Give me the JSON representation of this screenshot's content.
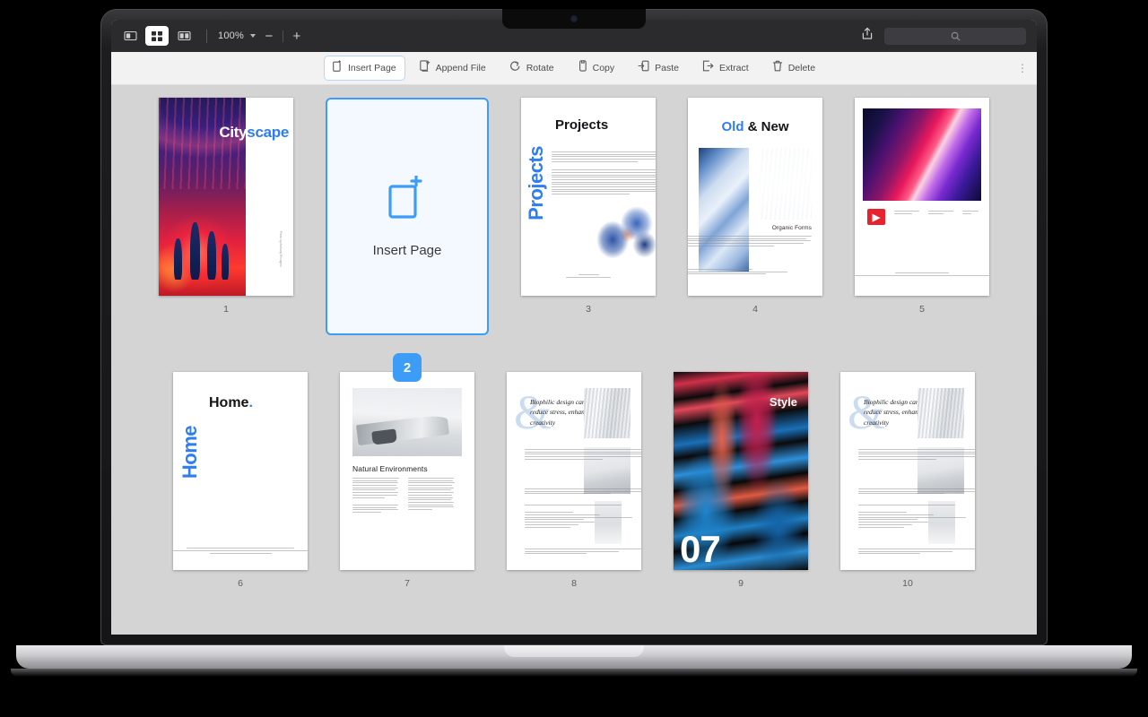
{
  "titlebar": {
    "view_icons": [
      {
        "name": "single-page-view-icon",
        "active": false
      },
      {
        "name": "thumbnail-grid-view-icon",
        "active": true
      },
      {
        "name": "two-page-view-icon",
        "active": false
      }
    ],
    "zoom_value": "100%",
    "zoom_out_label": "−",
    "zoom_in_label": "+",
    "share_icon": "share-icon",
    "search_icon": "search-icon",
    "search_placeholder": ""
  },
  "toolbar": {
    "items": [
      {
        "label": "Insert Page",
        "icon": "insert-page-icon",
        "selected": true
      },
      {
        "label": "Append File",
        "icon": "append-file-icon",
        "selected": false
      },
      {
        "label": "Rotate",
        "icon": "rotate-icon",
        "selected": false
      },
      {
        "label": "Copy",
        "icon": "copy-icon",
        "selected": false
      },
      {
        "label": "Paste",
        "icon": "paste-icon",
        "selected": false
      },
      {
        "label": "Extract",
        "icon": "extract-icon",
        "selected": false
      },
      {
        "label": "Delete",
        "icon": "delete-icon",
        "selected": false
      }
    ],
    "overflow_label": "⋮"
  },
  "insert_card": {
    "label": "Insert Page",
    "icon": "page-plus-icon",
    "accent_color": "#3d9cf5"
  },
  "drag_badge": {
    "value": "2",
    "color": "#3d9cf5"
  },
  "pages": {
    "p1": {
      "number": "1",
      "title_white": "City",
      "title_blue": "scape",
      "side_note": "Photo by Anthony Reungère"
    },
    "p3": {
      "number": "3",
      "title": "Projects",
      "vertical_title": "Projects",
      "footer_line1": "Photo by",
      "footer_line2": "Documentation for compilation"
    },
    "p4": {
      "number": "4",
      "title_blue": "Old",
      "title_dark": "& New",
      "subtitle": "Organic Forms"
    },
    "p5": {
      "number": "5",
      "logo_glyph": "▶"
    },
    "p6": {
      "number": "6",
      "title": "Home",
      "title_dot": ".",
      "vertical_title": "Home",
      "footer": "Photo by Anderson Rihanna, Cedric Stauffer, modeldesign on Unsplash"
    },
    "p7": {
      "number": "7",
      "title": "Natural Environments"
    },
    "p8": {
      "number": "8",
      "ampersand": "&",
      "quote": "Biophilic design can reduce stress, enhance creativity"
    },
    "p9": {
      "number": "9",
      "label": "Style",
      "big_number": "07"
    },
    "p10": {
      "number": "10",
      "ampersand": "&",
      "quote": "Biophilic design can reduce stress, enhance creativity"
    }
  }
}
